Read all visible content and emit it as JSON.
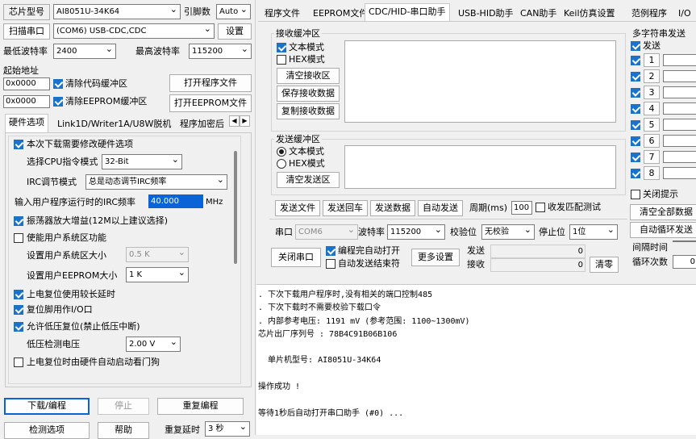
{
  "left": {
    "chip_label": "芯片型号",
    "chip_value": "AI8051U-34K64",
    "pins_label": "引脚数",
    "pins_value": "Auto",
    "scan_port": "扫描串口",
    "port_value": "(COM6) USB-CDC,CDC",
    "settings": "设置",
    "min_baud_label": "最低波特率",
    "min_baud": "2400",
    "max_baud_label": "最高波特率",
    "max_baud": "115200",
    "start_addr_label": "起始地址",
    "addr1": "0x0000",
    "clear_code": "清除代码缓冲区",
    "open_prog": "打开程序文件",
    "addr2": "0x0000",
    "clear_eeprom": "清除EEPROM缓冲区",
    "open_eeprom": "打开EEPROM文件",
    "tabs": [
      "硬件选项",
      "Link1D/Writer1A/U8W脱机",
      "程序加密后"
    ],
    "hw": {
      "modify_hw": "本次下载需要修改硬件选项",
      "cpu_label": "选择CPU指令模式",
      "cpu_value": "32-Bit",
      "irc_label": "IRC调节模式",
      "irc_value": "总是动态调节IRC频率",
      "freq_label": "输入用户程序运行时的IRC频率",
      "freq_value": "40.000",
      "freq_unit": "MHz",
      "osc_gain": "振荡器放大增益(12M以上建议选择)",
      "enable_sys": "使能用户系统区功能",
      "sys_size_label": "设置用户系统区大小",
      "sys_size": "0.5 K",
      "eeprom_size_label": "设置用户EEPROM大小",
      "eeprom_size": "1 K",
      "power_delay": "上电复位使用较长延时",
      "reset_io": "复位脚用作I/O口",
      "lvr": "允许低压复位(禁止低压中断)",
      "lvd_label": "低压检测电压",
      "lvd_value": "2.00 V",
      "wdt": "上电复位时由硬件自动启动看门狗"
    },
    "download": "下载/编程",
    "stop": "停止",
    "reprogram": "重复编程",
    "detect": "检测选项",
    "help": "帮助",
    "delay_label": "重复延时",
    "delay_value": "3 秒"
  },
  "right": {
    "tabs": [
      "程序文件",
      "EEPROM文件",
      "CDC/HID-串口助手",
      "USB-HID助手",
      "CAN助手",
      "Keil仿真设置",
      "范例程序",
      "I/O"
    ],
    "recv": {
      "title": "接收缓冲区",
      "text_mode": "文本模式",
      "hex_mode": "HEX模式",
      "clear": "清空接收区",
      "save": "保存接收数据",
      "copy": "复制接收数据"
    },
    "send": {
      "title": "发送缓冲区",
      "text_mode": "文本模式",
      "hex_mode": "HEX模式",
      "clear": "清空发送区"
    },
    "send_file": "发送文件",
    "send_enter": "发送回车",
    "send_data": "发送数据",
    "auto_send": "自动发送",
    "period_label": "周期(ms)",
    "period_value": "100",
    "hex_match": "收发匹配测试",
    "port_label": "串口",
    "port_value": "COM6",
    "baud_label": "波特率",
    "baud_value": "115200",
    "parity_label": "校验位",
    "parity_value": "无校验",
    "stop_label": "停止位",
    "stop_value": "1位",
    "close_port": "关闭串口",
    "auto_open": "编程完自动打开",
    "auto_end": "自动发送结束符",
    "more": "更多设置",
    "sent_label": "发送",
    "sent_value": "0",
    "recv_label": "接收",
    "recv_value": "0",
    "zero": "清零",
    "multi": {
      "title": "多字符串发送",
      "send": "发送",
      "items": [
        "1",
        "2",
        "3",
        "4",
        "5",
        "6",
        "7",
        "8"
      ],
      "close_hint": "关闭提示",
      "clear_all": "清空全部数据",
      "auto_loop": "自动循环发送",
      "interval_label": "间隔时间",
      "loop_label": "循环次数",
      "loop_value": "0"
    }
  },
  "log": [
    ". 下次下载用户程序时,没有相关的端口控制485",
    ". 下次下载时不需要校验下载口令",
    ". 内部参考电压: 1191 mV (参考范围: 1100~1300mV)",
    "芯片出厂序列号 : 78B4C91B06B106",
    "",
    "  单片机型号: AI8051U-34K64",
    "",
    "操作成功 !",
    "",
    "等待1秒后自动打开串口助手 (#0) ..."
  ]
}
